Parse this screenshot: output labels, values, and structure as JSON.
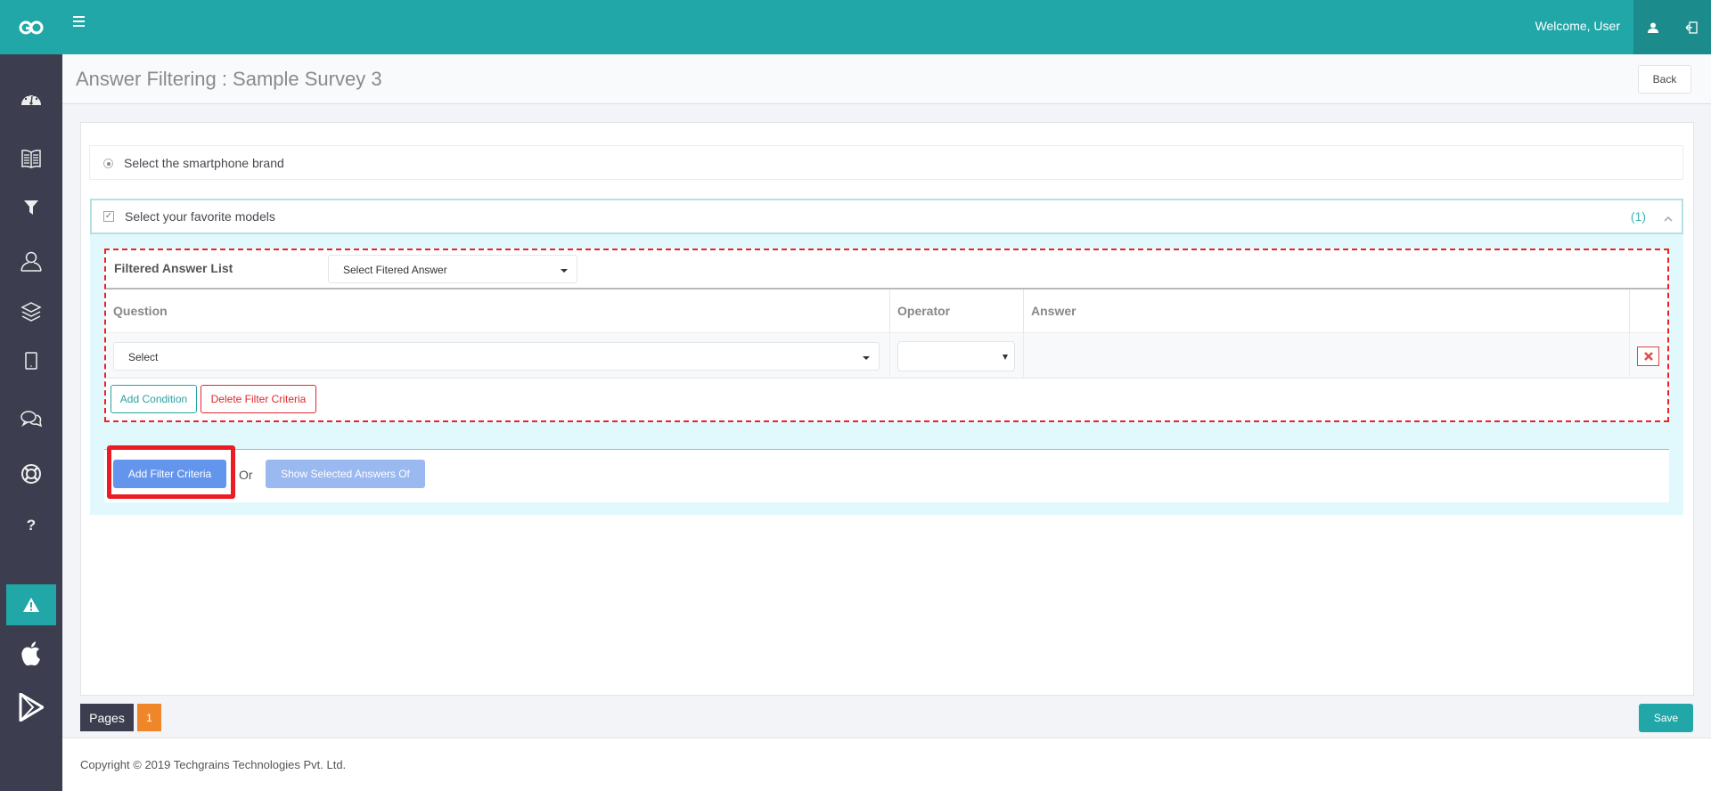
{
  "header": {
    "logo_icon": "go-logo-icon",
    "menu_icon": "hamburger-icon",
    "welcome_text": "Welcome, User",
    "user_icon": "user-icon",
    "logout_icon": "sign-out-icon"
  },
  "sidebar": {
    "items": [
      {
        "icon": "dashboard-icon",
        "active": false
      },
      {
        "icon": "book-icon",
        "active": false
      },
      {
        "icon": "filter-icon",
        "active": false
      },
      {
        "icon": "user-outline-icon",
        "active": false
      },
      {
        "icon": "layers-icon",
        "active": false
      },
      {
        "icon": "tablet-icon",
        "active": false
      },
      {
        "icon": "chat-icon",
        "active": false
      },
      {
        "icon": "life-ring-icon",
        "active": false
      },
      {
        "icon": "question-icon",
        "active": false
      },
      {
        "icon": "warning-icon",
        "active": true
      },
      {
        "icon": "apple-icon",
        "active": false
      },
      {
        "icon": "play-store-icon",
        "active": false
      }
    ]
  },
  "page": {
    "title": "Answer Filtering : Sample Survey 3",
    "back_label": "Back"
  },
  "questions": [
    {
      "type": "radio",
      "text": "Select the smartphone brand"
    },
    {
      "type": "checkbox",
      "text": "Select your favorite models",
      "count": "(1)",
      "expanded": true
    }
  ],
  "filter": {
    "list_label": "Filtered Answer List",
    "list_select_value": "Select Fitered Answer",
    "columns": [
      "Question",
      "Operator",
      "Answer",
      ""
    ],
    "rows": [
      {
        "question": "Select",
        "operator": "",
        "answer": ""
      }
    ],
    "add_condition_label": "Add Condition",
    "delete_criteria_label": "Delete Filter Criteria",
    "add_filter_label": "Add Filter Criteria",
    "or_label": "Or",
    "show_selected_label": "Show Selected Answers Of"
  },
  "pagination": {
    "label": "Pages",
    "pages": [
      "1"
    ]
  },
  "save_label": "Save",
  "footer": {
    "copyright": "Copyright © 2019 Techgrains Technologies Pvt. Ltd."
  },
  "colors": {
    "brand": "#21a7a8",
    "sidebar": "#3c3e4f",
    "danger": "#ef2128",
    "primary": "#6495ed",
    "page_badge": "#f0862a"
  }
}
